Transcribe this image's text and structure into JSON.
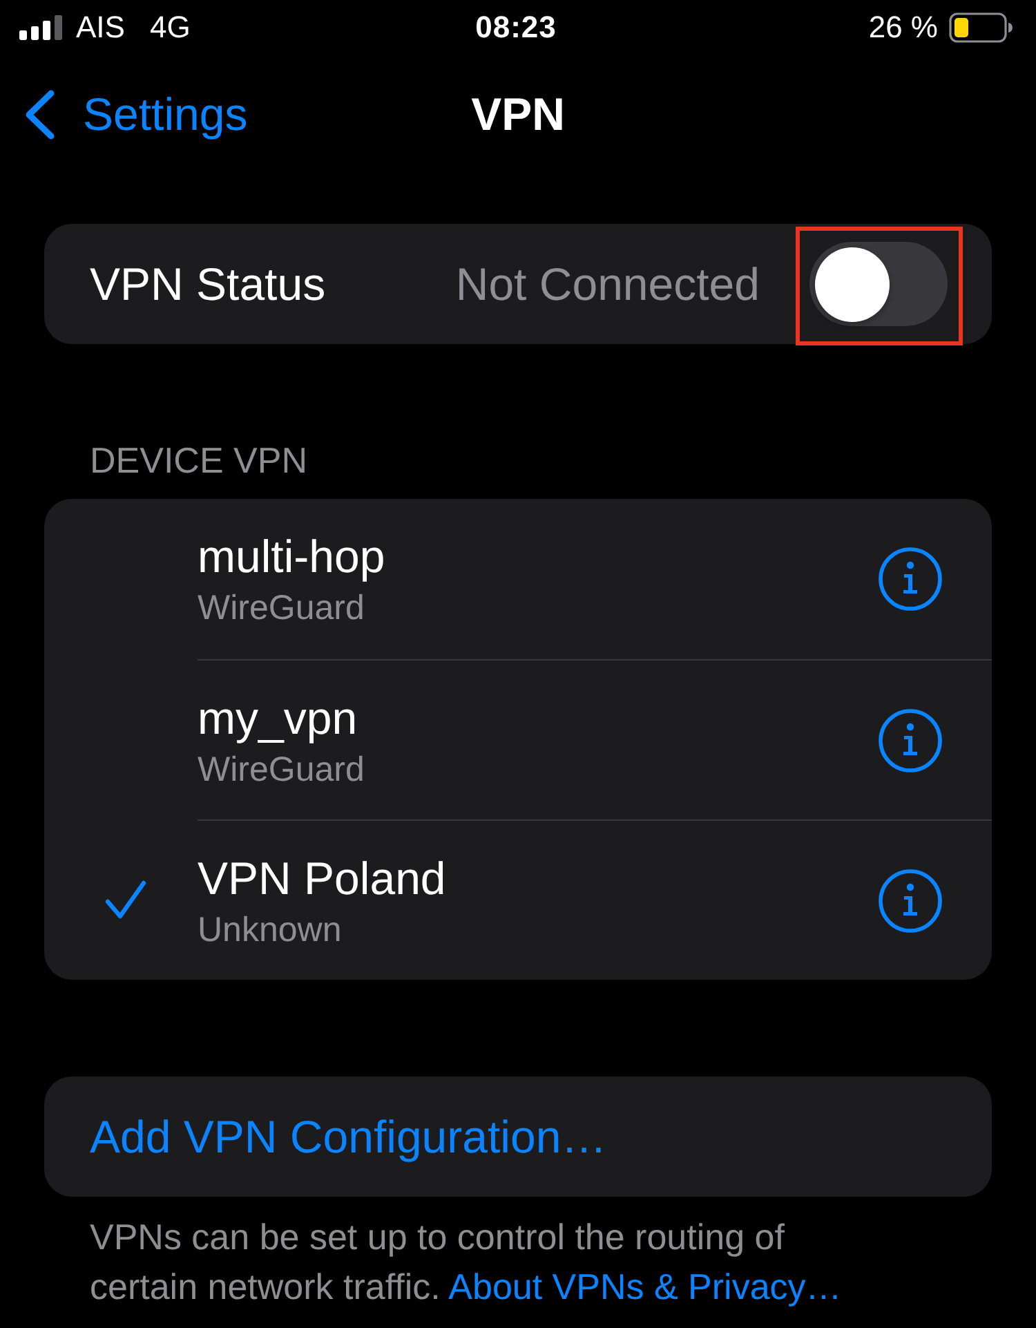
{
  "status_bar": {
    "carrier": "AIS",
    "network": "4G",
    "time": "08:23",
    "battery": "26 %"
  },
  "nav": {
    "back": "Settings",
    "title": "VPN"
  },
  "vpn_status": {
    "label": "VPN Status",
    "value": "Not Connected",
    "on": false,
    "highlighted": true
  },
  "device_vpn": {
    "header": "DEVICE VPN",
    "items": [
      {
        "name": "multi-hop",
        "type": "WireGuard",
        "selected": false
      },
      {
        "name": "my_vpn",
        "type": "WireGuard",
        "selected": false
      },
      {
        "name": "VPN Poland",
        "type": "Unknown",
        "selected": true
      }
    ]
  },
  "add_button": "Add VPN Configuration…",
  "footer": {
    "text": "VPNs can be set up to control the routing of certain network traffic.",
    "link": "About VPNs & Privacy…"
  }
}
